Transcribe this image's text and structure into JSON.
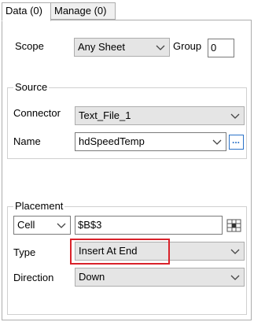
{
  "tabs": [
    "Data (0)",
    "Manage (0)"
  ],
  "scope": {
    "label": "Scope",
    "value": "Any Sheet",
    "group_label": "Group",
    "group_value": "0"
  },
  "source": {
    "title": "Source",
    "connector_label": "Connector",
    "connector_value": "Text_File_1",
    "name_label": "Name",
    "name_value": "hdSpeedTemp",
    "browse_glyph": "..."
  },
  "placement": {
    "title": "Placement",
    "mode_value": "Cell",
    "address_value": "$B$3",
    "type_label": "Type",
    "type_value": "Insert At End",
    "direction_label": "Direction",
    "direction_value": "Down"
  },
  "colors": {
    "highlight": "#d9222a",
    "browse_border": "#2a72c8"
  }
}
